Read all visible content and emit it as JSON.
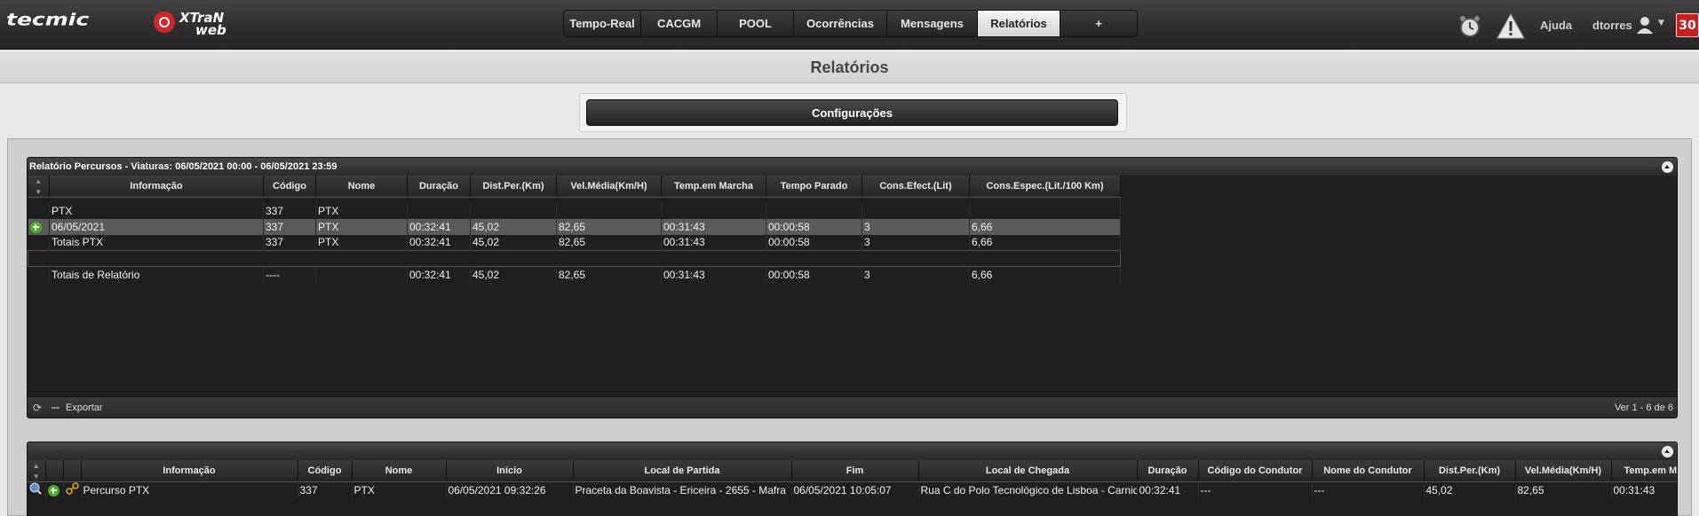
{
  "header": {
    "logo_text": "tecmic",
    "product_logo_line1": "XTraN",
    "product_logo_line2": "web",
    "nav_tabs": [
      {
        "label": "Tempo-Real",
        "active": false
      },
      {
        "label": "CACGM",
        "active": false
      },
      {
        "label": "POOL",
        "active": false
      },
      {
        "label": "Ocorrências",
        "active": false
      },
      {
        "label": "Mensagens",
        "active": false
      },
      {
        "label": "Relatórios",
        "active": true
      },
      {
        "label": "+",
        "active": false
      }
    ],
    "help_label": "Ajuda",
    "username": "dtorres",
    "notification_count": "30",
    "icons": [
      "alarm-clock-icon",
      "warning-icon",
      "user-icon",
      "caret-down-icon"
    ]
  },
  "page": {
    "title": "Relatórios",
    "config_button": "Configurações"
  },
  "report": {
    "title": "Relatório Percursos - Viaturas: 06/05/2021 00:00 - 06/05/2021 23:59",
    "columns": [
      "Informação",
      "Código",
      "Nome",
      "Duração",
      "Dist.Per.(Km)",
      "Vel.Média(Km/H)",
      "Temp.em Marcha",
      "Tempo Parado",
      "Cons.Efect.(Lit)",
      "Cons.Espec.(Lit./100 Km)"
    ],
    "rows": [
      {
        "info": "PTX",
        "codigo": "337",
        "nome": "PTX",
        "duracao": "",
        "dist": "",
        "vel": "",
        "marcha": "",
        "parado": "",
        "efect": "",
        "espec": "",
        "expand": false,
        "selected": false
      },
      {
        "info": "06/05/2021",
        "codigo": "337",
        "nome": "PTX",
        "duracao": "00:32:41",
        "dist": "45,02",
        "vel": "82,65",
        "marcha": "00:31:43",
        "parado": "00:00:58",
        "efect": "3",
        "espec": "6,66",
        "expand": true,
        "selected": true
      },
      {
        "info": "Totais PTX",
        "codigo": "337",
        "nome": "PTX",
        "duracao": "00:32:41",
        "dist": "45,02",
        "vel": "82,65",
        "marcha": "00:31:43",
        "parado": "00:00:58",
        "efect": "3",
        "espec": "6,66",
        "expand": false,
        "selected": false
      },
      {
        "info": "",
        "codigo": "",
        "nome": "",
        "duracao": "",
        "dist": "",
        "vel": "",
        "marcha": "",
        "parado": "",
        "efect": "",
        "espec": "",
        "expand": false,
        "selected": false,
        "blank": true
      },
      {
        "info": "Totais de Relatório",
        "codigo": "----",
        "nome": "",
        "duracao": "00:32:41",
        "dist": "45,02",
        "vel": "82,65",
        "marcha": "00:31:43",
        "parado": "00:00:58",
        "efect": "3",
        "espec": "6,66",
        "expand": false,
        "selected": false
      }
    ],
    "footer_export": "Exportar",
    "footer_paging": "Ver 1 - 6 de 6"
  },
  "detail": {
    "columns": [
      "Informação",
      "Código",
      "Nome",
      "Início",
      "Local de Partida",
      "Fim",
      "Local de Chegada",
      "Duração",
      "Código do Condutor",
      "Nome do Condutor",
      "Dist.Per.(Km)",
      "Vel.Média(Km/H)",
      "Temp.em Marcha"
    ],
    "rows": [
      {
        "info": "Percurso PTX",
        "codigo": "337",
        "nome": "PTX",
        "inicio": "06/05/2021 09:32:26",
        "partida": "Praceta da Boavista - Ericeira - 2655 - Mafra",
        "fim": "06/05/2021 10:05:07",
        "chegada": "Rua C do Polo Tecnológico de Lisboa - Carnide",
        "duracao": "00:32:41",
        "cod_condutor": "---",
        "nome_condutor": "---",
        "dist": "45,02",
        "vel": "82,65",
        "marcha": "00:31:43"
      }
    ]
  },
  "colors": {
    "accent_active_tab": "#e6e6e6",
    "badge": "#c91f1f",
    "expand_icon": "#4caf24"
  }
}
